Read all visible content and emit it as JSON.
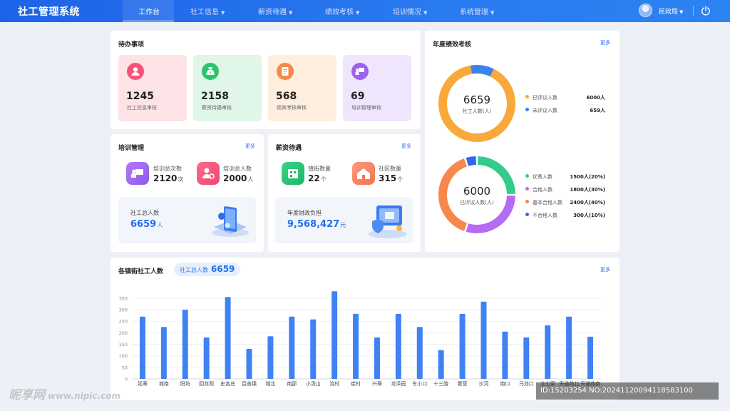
{
  "app": {
    "title": "社工管理系统"
  },
  "nav": [
    {
      "label": "工作台",
      "active": true
    },
    {
      "label": "社工信息",
      "active": false
    },
    {
      "label": "薪资待遇",
      "active": false
    },
    {
      "label": "绩效考核",
      "active": false
    },
    {
      "label": "培训情况",
      "active": false
    },
    {
      "label": "系统管理",
      "active": false
    }
  ],
  "user": {
    "name": "民政局"
  },
  "todo": {
    "title": "待办事项",
    "tiles": [
      {
        "value": "1245",
        "label": "社工信息审核",
        "bg": "#fde3e6",
        "icon_bg": "#f5527a",
        "icon": "user-icon"
      },
      {
        "value": "2158",
        "label": "薪资待遇审核",
        "bg": "#dff6e9",
        "icon_bg": "#2cc36b",
        "icon": "money-bag-icon"
      },
      {
        "value": "568",
        "label": "绩效考核审核",
        "bg": "#fdeedd",
        "icon_bg": "#f7874a",
        "icon": "document-icon"
      },
      {
        "value": "69",
        "label": "培训管理审核",
        "bg": "#efe6fd",
        "icon_bg": "#9b62ef",
        "icon": "training-icon"
      }
    ]
  },
  "training": {
    "title": "培训管理",
    "more": "更多",
    "stats": [
      {
        "label": "培训总次数",
        "value": "2120",
        "unit": "次"
      },
      {
        "label": "培训总人数",
        "value": "2000",
        "unit": "人"
      }
    ],
    "summary": {
      "label": "社工总人数",
      "value": "6659",
      "unit": "人"
    }
  },
  "salary": {
    "title": "薪资待遇",
    "more": "更多",
    "stats": [
      {
        "label": "镇街数量",
        "value": "22",
        "unit": "个"
      },
      {
        "label": "社区数量",
        "value": "315",
        "unit": "个"
      }
    ],
    "summary": {
      "label": "年度财政负担",
      "value": "9,568,427",
      "unit": "元"
    }
  },
  "performance": {
    "title": "年度绩效考核",
    "more": "更多",
    "donut1": {
      "center_value": "6659",
      "center_label": "社工人数(人)",
      "items": [
        {
          "label": "已评议人数",
          "value": "6000人",
          "count": 6000,
          "color": "#f9a93a"
        },
        {
          "label": "未评议人数",
          "value": "659人",
          "count": 659,
          "color": "#3b82f0"
        }
      ]
    },
    "donut2": {
      "center_value": "6000",
      "center_label": "已评议人数(人)",
      "items": [
        {
          "label": "优秀人数",
          "value": "1500人(20%)",
          "count": 1500,
          "color": "#33cc8a"
        },
        {
          "label": "合格人数",
          "value": "1800人(30%)",
          "count": 1800,
          "color": "#b46cf2"
        },
        {
          "label": "基本合格人数",
          "value": "2400人(40%)",
          "count": 2400,
          "color": "#f7874a"
        },
        {
          "label": "不合格人数",
          "value": "300人(10%)",
          "count": 300,
          "color": "#3366ee"
        }
      ]
    }
  },
  "street": {
    "title": "各镇街社工人数",
    "more": "更多",
    "pill_label": "社工总人数",
    "pill_value": "6659"
  },
  "chart_data": {
    "type": "bar",
    "title": "各镇街社工人数",
    "categories": [
      "延寿",
      "城南",
      "阳坊",
      "回龙观",
      "史各庄",
      "百善镇",
      "城北",
      "南邵",
      "小汤山",
      "流村",
      "崔村",
      "兴寿",
      "龙泽园",
      "东小口",
      "十三陵",
      "霍营",
      "沙河",
      "南口",
      "马池口",
      "北七家",
      "天通苑北",
      "天通苑南"
    ],
    "values": [
      270,
      225,
      300,
      180,
      355,
      130,
      185,
      270,
      258,
      380,
      282,
      180,
      282,
      225,
      125,
      282,
      335,
      205,
      180,
      232,
      270,
      183
    ],
    "yticks": [
      0,
      50,
      100,
      150,
      200,
      250,
      300,
      350
    ],
    "ylim": [
      0,
      390
    ],
    "grid": true,
    "color": "#3f82f3"
  },
  "watermark": {
    "text": "昵享网",
    "url": "www.nipic.com"
  },
  "image_id": "ID:15203254 NO:20241120094118583100"
}
